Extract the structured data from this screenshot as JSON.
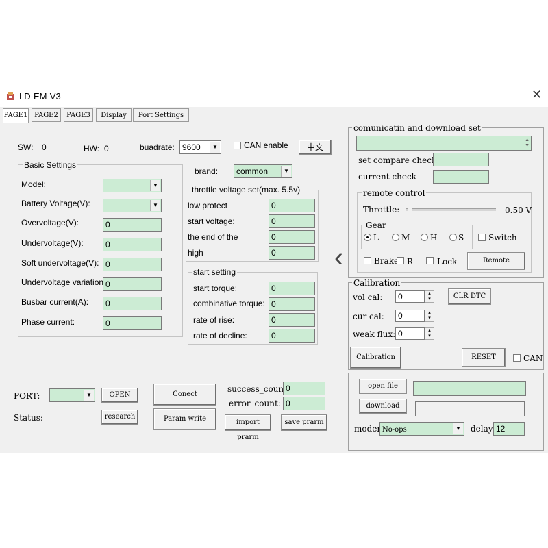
{
  "window": {
    "title": "LD-EM-V3",
    "close": "✕"
  },
  "tabs": [
    "PAGE1",
    "PAGE2",
    "PAGE3",
    "Display",
    "Port Settings"
  ],
  "top": {
    "sw_label": "SW:",
    "sw_value": "0",
    "hw_label": "HW:",
    "hw_value": "0",
    "baud_label": "buadrate:",
    "baud_value": "9600",
    "can_label": "CAN enable",
    "lang_button": "中文"
  },
  "basic": {
    "title": "Basic Settings",
    "model_label": "Model:",
    "battery_label": "Battery Voltage(V):",
    "overvoltage_label": "Overvoltage(V):",
    "overvoltage_value": "0",
    "undervoltage_label": "Undervoltage(V):",
    "undervoltage_value": "0",
    "soft_label": "Soft undervoltage(V):",
    "soft_value": "0",
    "variation_label": "Undervoltage variation:",
    "variation_value": "0",
    "busbar_label": "Busbar current(A):",
    "busbar_value": "0",
    "phase_label": "Phase current:",
    "phase_value": "0"
  },
  "brand": {
    "label": "brand:",
    "value": "common"
  },
  "throttle": {
    "title": "throttle voltage set(max. 5.5v)",
    "low_label": "low protect",
    "low_value": "0",
    "start_label": "start voltage:",
    "start_value": "0",
    "end_label": "the end of the",
    "end_value": "0",
    "high_label": "high",
    "high_value": "0"
  },
  "start": {
    "title": "start setting",
    "torque_label": "start torque:",
    "torque_value": "0",
    "comb_label": "combinative torque:",
    "comb_value": "0",
    "rise_label": "rate of rise:",
    "rise_value": "0",
    "decline_label": "rate of decline:",
    "decline_value": "0"
  },
  "bottom": {
    "port_label": "PORT:",
    "open_button": "OPEN",
    "connect_button": "Conect",
    "status_label": "Status:",
    "research_button": "research",
    "param_write_button": "Param write",
    "success_label": "success_count:",
    "success_value": "0",
    "error_label": "error_count:",
    "error_value": "0",
    "import_button": "import prarm",
    "save_button": "save prarm"
  },
  "comm": {
    "title": "comunicatin and download set",
    "set_compare_label": "set compare check",
    "current_check_label": "current check"
  },
  "remote": {
    "title": "remote control",
    "throttle_label": "Throttle:",
    "throttle_value": "0.50 V",
    "throttle_level": 0.02,
    "gear_title": "Gear",
    "gears": [
      "L",
      "M",
      "H",
      "S"
    ],
    "gear_selected": "L",
    "switch_label": "Switch",
    "brake_label": "Brake",
    "r_label": "R",
    "lock_label": "Lock",
    "remote_button": "Remote"
  },
  "calibration": {
    "title": "Calibration",
    "vol_label": "vol cal:",
    "vol_value": "0",
    "cur_label": "cur cal:",
    "cur_value": "0",
    "weak_label": "weak flux:",
    "weak_value": "0",
    "clr_button": "CLR DTC",
    "calibration_button": "Calibration",
    "reset_button": "RESET",
    "can_label": "CAN"
  },
  "download": {
    "open_file_button": "open file",
    "download_button": "download",
    "moden_label": "moden:",
    "moden_value": "No-ops",
    "delay_label": "delay:",
    "delay_value": "12"
  },
  "collapse_arrow": "‹"
}
